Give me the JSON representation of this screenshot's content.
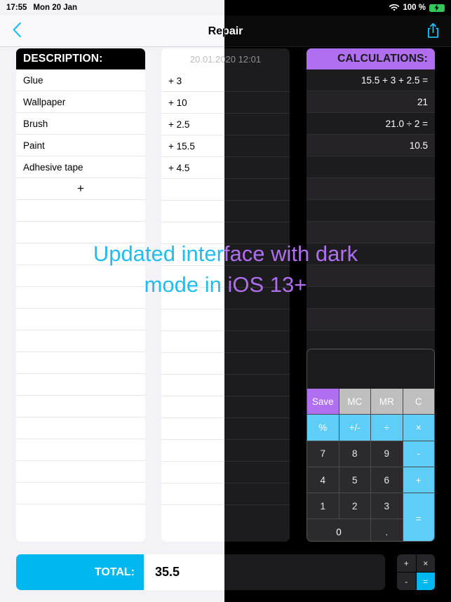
{
  "statusbar": {
    "time": "17:55",
    "date": "Mon 20 Jan",
    "wifi_icon": "wifi-icon",
    "battery_percent": "100 %",
    "battery_icon": "battery-charging-icon"
  },
  "navbar": {
    "back_icon": "chevron-left-icon",
    "title": "Repair",
    "share_icon": "share-icon"
  },
  "description_panel": {
    "header": "DESCRIPTION:",
    "items": [
      "Glue",
      "Wallpaper",
      "Brush",
      "Paint",
      "Adhesive tape"
    ],
    "add_label": "+",
    "empty_rows": 14
  },
  "amount_panel": {
    "timestamp": "20.01.2020 12:01",
    "items": [
      "+ 3",
      "+ 10",
      "+ 2.5",
      "+ 15.5",
      "+ 4.5"
    ],
    "empty_rows": 15
  },
  "calculations_panel": {
    "header": "CALCULATIONS:",
    "rows": [
      {
        "text": "15.5 + 3 + 2.5 =",
        "kind": "expression"
      },
      {
        "text": "21",
        "kind": "result"
      },
      {
        "text": "21.0 ÷ 2 =",
        "kind": "expression"
      },
      {
        "text": "10.5",
        "kind": "result"
      }
    ],
    "empty_rows": 8
  },
  "keypad": {
    "display_value": "",
    "keys": [
      {
        "label": "Save",
        "type": "save"
      },
      {
        "label": "MC",
        "type": "mem"
      },
      {
        "label": "MR",
        "type": "mem"
      },
      {
        "label": "C",
        "type": "mem"
      },
      {
        "label": "%",
        "type": "op"
      },
      {
        "label": "+/-",
        "type": "op"
      },
      {
        "label": "÷",
        "type": "op"
      },
      {
        "label": "×",
        "type": "op"
      },
      {
        "label": "7",
        "type": "num"
      },
      {
        "label": "8",
        "type": "num"
      },
      {
        "label": "9",
        "type": "num"
      },
      {
        "label": "-",
        "type": "op"
      },
      {
        "label": "4",
        "type": "num"
      },
      {
        "label": "5",
        "type": "num"
      },
      {
        "label": "6",
        "type": "num"
      },
      {
        "label": "+",
        "type": "op"
      },
      {
        "label": "1",
        "type": "num"
      },
      {
        "label": "2",
        "type": "num"
      },
      {
        "label": "3",
        "type": "num"
      },
      {
        "label": "=",
        "type": "eq"
      },
      {
        "label": "0",
        "type": "zero"
      },
      {
        "label": ".",
        "type": "num"
      }
    ]
  },
  "bottom_bar": {
    "total_label": "TOTAL:",
    "total_value": "35.5",
    "mini_keys": [
      "+",
      "×",
      "-",
      "="
    ]
  },
  "caption": {
    "line1": "Updated interface with dark",
    "line2": "mode in iOS 13+"
  },
  "colors": {
    "accent_cyan": "#00b8f0",
    "accent_purple": "#b06ef0",
    "light_bg": "#f2f2f7",
    "dark_bg": "#000000",
    "dark_panel": "#1c1c1e"
  }
}
